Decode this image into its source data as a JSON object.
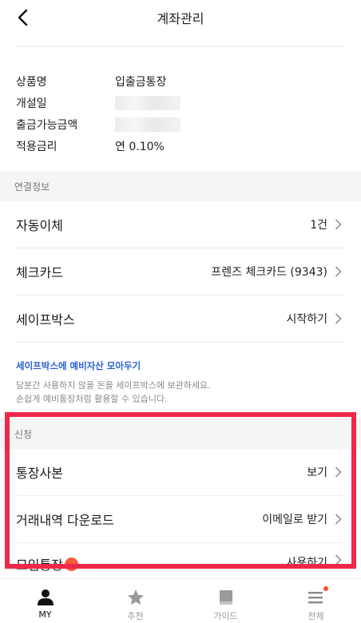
{
  "header": {
    "title": "계좌관리"
  },
  "account": {
    "rows": [
      {
        "label": "상품명",
        "value": "입출금통장"
      },
      {
        "label": "개설일",
        "value": ""
      },
      {
        "label": "출금가능금액",
        "value": ""
      },
      {
        "label": "적용금리",
        "value": "연 0.10%"
      }
    ]
  },
  "linked": {
    "section_title": "연결정보",
    "items": [
      {
        "label": "자동이체",
        "value": "1건"
      },
      {
        "label": "체크카드",
        "value": "프렌즈 체크카드 (9343)"
      },
      {
        "label": "세이프박스",
        "value": "시작하기"
      }
    ]
  },
  "promo": {
    "link": "세이프박스에 예비자산 모아두기",
    "line1": "당분간 사용하지 않을 돈을 세이프박스에 보관하세요.",
    "line2": "손쉽게 예비통장처럼 활용할 수 있습니다."
  },
  "apply": {
    "section_title": "신청",
    "items": [
      {
        "label": "통장사본",
        "value": "보기"
      },
      {
        "label": "거래내역 다운로드",
        "value": "이메일로 받기"
      },
      {
        "label": "모임통장",
        "value": "사용하기"
      }
    ]
  },
  "tabbar": {
    "tabs": [
      {
        "label": "MY",
        "icon": "person-icon",
        "active": true
      },
      {
        "label": "추천",
        "icon": "star-icon"
      },
      {
        "label": "가이드",
        "icon": "book-icon"
      },
      {
        "label": "전체",
        "icon": "menu-icon"
      }
    ]
  },
  "colors": {
    "highlight": "#ee2947",
    "link": "#2b5fd6",
    "badge": "#ff5a3c"
  }
}
